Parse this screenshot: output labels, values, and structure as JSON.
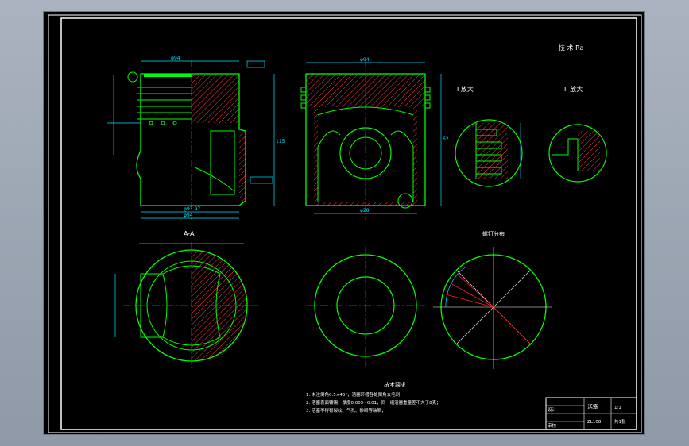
{
  "drawing": {
    "top_note": "技 术 Ra",
    "section_label": "A-A",
    "detail_1_label": "I 放大",
    "detail_2_label": "II 放大",
    "polar_label": "螺钉分布",
    "tech_req_title": "技术要求",
    "tech_req_lines": [
      "1. 未注倒角0.5×45°，活塞环槽各处倒角去毛刺；",
      "2. 活塞表面镀锡，厚度0.005~0.01，同一组活塞重量差不大于8克；",
      "3. 活塞不得有裂纹、气孔、砂眼等缺陷；"
    ],
    "dims": {
      "d_top": "φ94",
      "d_skirt": "φ93.97",
      "d_bottom": "φ94",
      "d_pin": "φ28",
      "h_total": "115",
      "h_pin": "62"
    }
  },
  "title_block": {
    "name": "活塞",
    "scale": "1:1",
    "sheet": "共1张",
    "material": "ZL108",
    "designer": "设计",
    "checker": "审核"
  },
  "colors": {
    "outline": "#00ff00",
    "dimension": "#00e5ff",
    "center": "#ff2020",
    "hatch": "#ff4040",
    "text": "#ffffff",
    "frame": "#ffffff"
  }
}
